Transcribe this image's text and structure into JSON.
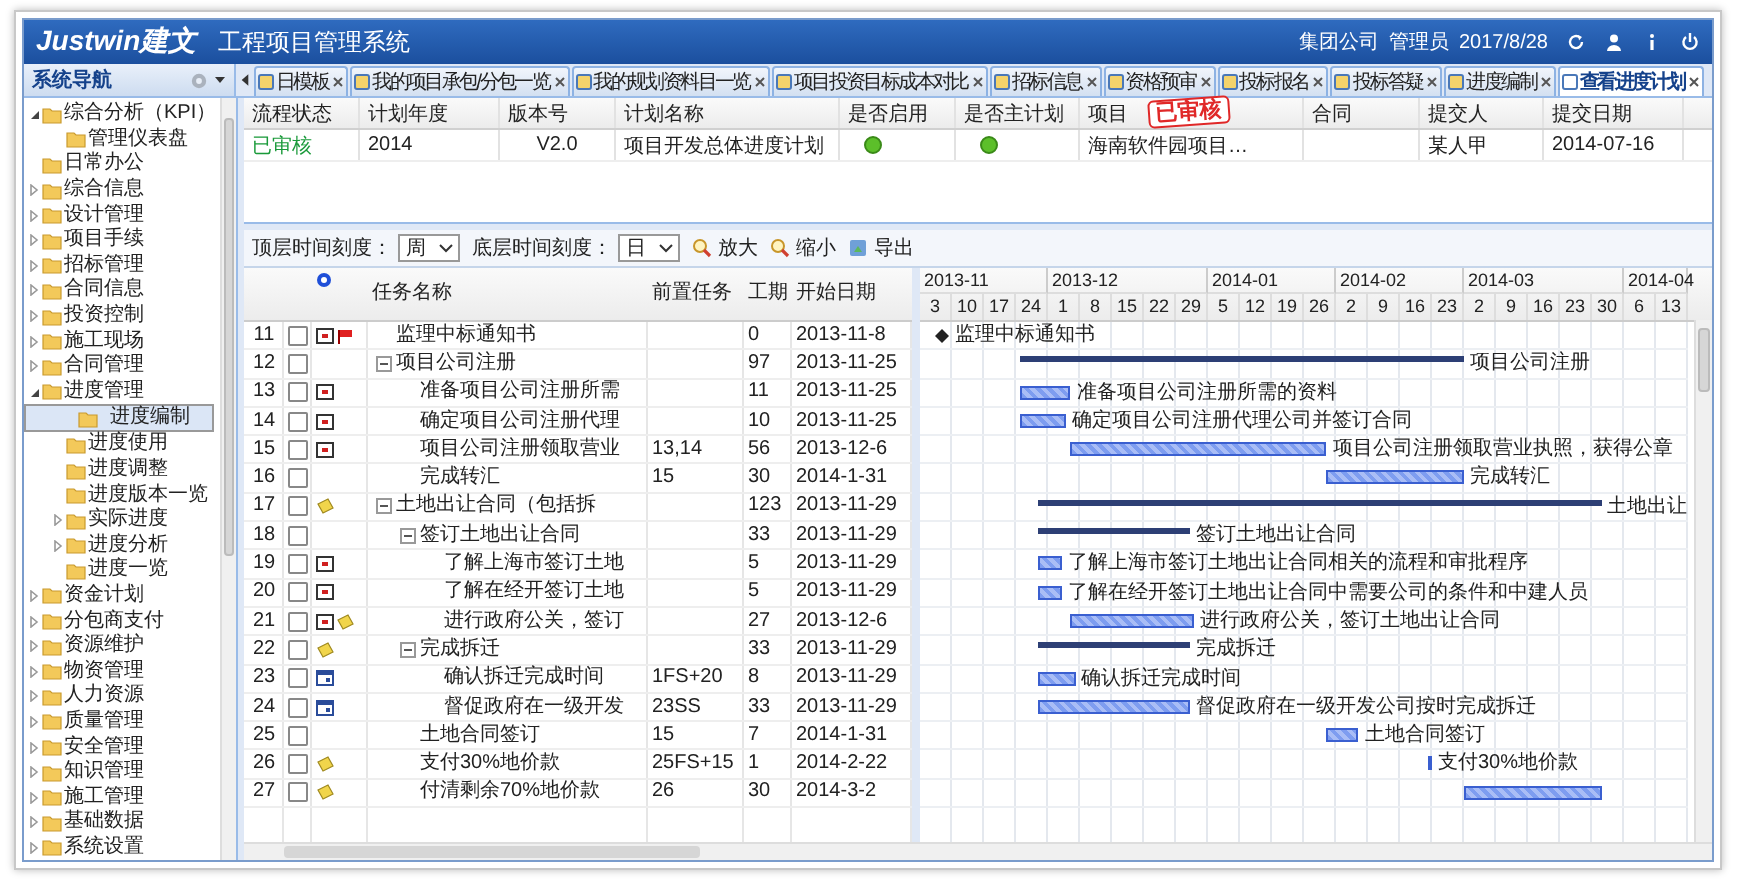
{
  "header": {
    "logo": "Justwin建文",
    "title": "工程项目管理系统",
    "company": "集团公司",
    "user": "管理员",
    "date": "2017/8/28"
  },
  "sidebar": {
    "title": "系统导航",
    "items": [
      {
        "label": "综合分析（KPI）",
        "expanded": true,
        "selected": false,
        "children": [
          {
            "label": "管理仪表盘",
            "selected": false
          }
        ]
      },
      {
        "label": "日常办公",
        "selected": false
      },
      {
        "label": "综合信息",
        "expanded": false,
        "selected": false
      },
      {
        "label": "设计管理",
        "expanded": false,
        "selected": false
      },
      {
        "label": "项目手续",
        "expanded": false,
        "selected": false
      },
      {
        "label": "招标管理",
        "expanded": false,
        "selected": false
      },
      {
        "label": "合同信息",
        "expanded": false,
        "selected": false
      },
      {
        "label": "投资控制",
        "expanded": false,
        "selected": false
      },
      {
        "label": "施工现场",
        "expanded": false,
        "selected": false
      },
      {
        "label": "合同管理",
        "expanded": false,
        "selected": false
      },
      {
        "label": "进度管理",
        "expanded": true,
        "selected": false,
        "children": [
          {
            "label": "进度编制",
            "selected": true
          },
          {
            "label": "进度使用",
            "selected": false
          },
          {
            "label": "进度调整",
            "selected": false
          },
          {
            "label": "进度版本一览",
            "selected": false
          },
          {
            "label": "实际进度",
            "expanded": false,
            "selected": false
          },
          {
            "label": "进度分析",
            "expanded": false,
            "selected": false
          },
          {
            "label": "进度一览",
            "selected": false
          }
        ]
      },
      {
        "label": "资金计划",
        "expanded": false,
        "selected": false
      },
      {
        "label": "分包商支付",
        "expanded": false,
        "selected": false
      },
      {
        "label": "资源维护",
        "expanded": false,
        "selected": false
      },
      {
        "label": "物资管理",
        "expanded": false,
        "selected": false
      },
      {
        "label": "人力资源",
        "expanded": false,
        "selected": false
      },
      {
        "label": "质量管理",
        "expanded": false,
        "selected": false
      },
      {
        "label": "安全管理",
        "expanded": false,
        "selected": false
      },
      {
        "label": "知识管理",
        "expanded": false,
        "selected": false
      },
      {
        "label": "施工管理",
        "expanded": false,
        "selected": false
      },
      {
        "label": "基础数据",
        "expanded": false,
        "selected": false
      },
      {
        "label": "系统设置",
        "expanded": false,
        "selected": false
      }
    ]
  },
  "tabs": [
    {
      "label": "日模板",
      "selected": false
    },
    {
      "label": "我的项目承包/分包一览",
      "selected": false
    },
    {
      "label": "我的规划资料目一览",
      "selected": false
    },
    {
      "label": "项目投资目标成本对比",
      "selected": false
    },
    {
      "label": "招标信息",
      "selected": false
    },
    {
      "label": "资格预审",
      "selected": false
    },
    {
      "label": "投标报名",
      "selected": false
    },
    {
      "label": "投标答疑",
      "selected": false
    },
    {
      "label": "进度编制",
      "selected": false
    },
    {
      "label": "查看进度计划",
      "selected": true
    }
  ],
  "plan_table": {
    "columns": [
      "流程状态",
      "计划年度",
      "版本号",
      "计划名称",
      "是否启用",
      "是否主计划",
      "项目",
      "合同",
      "提交人",
      "提交日期"
    ],
    "stamp": "已审核",
    "rows": [
      {
        "status": "已审核",
        "year": "2014",
        "version": "V2.0",
        "name": "项目开发总体进度计划",
        "enabled": true,
        "main_plan": true,
        "project": "海南软件园项目…",
        "submitter": "某人甲",
        "date": "2014-07-16"
      }
    ]
  },
  "toolbar": {
    "top_scale_label": "顶层时间刻度：",
    "top_scale": "周",
    "bottom_scale_label": "底层时间刻度：",
    "bottom_scale": "日",
    "zoom_in": "放大",
    "zoom_out": "缩小",
    "export": "导出"
  },
  "gantt": {
    "columns": [
      "任务名称",
      "前置任务",
      "工期",
      "开始日期"
    ],
    "timeline": [
      {
        "label": "2013-11",
        "days": [
          "3",
          "10",
          "17",
          "24"
        ]
      },
      {
        "label": "2013-12",
        "days": [
          "1",
          "8",
          "15",
          "22",
          "29"
        ]
      },
      {
        "label": "2014-01",
        "days": [
          "5",
          "12",
          "19",
          "26"
        ]
      },
      {
        "label": "2014-02",
        "days": [
          "2",
          "9",
          "16",
          "23"
        ]
      },
      {
        "label": "2014-03",
        "days": [
          "2",
          "9",
          "16",
          "23",
          "30"
        ]
      },
      {
        "label": "2014-04",
        "days": [
          "6",
          "13"
        ]
      }
    ],
    "rows": [
      {
        "no": "11",
        "checked": false,
        "markers": [
          {
            "kind": "doc"
          },
          {
            "kind": "flag"
          }
        ],
        "kind": "milestone",
        "name": "监理中标通知书",
        "duration": "0",
        "start": "2013-11-8",
        "milestone_label": "监理中标通知书"
      },
      {
        "no": "12",
        "checked": false,
        "kind": "group",
        "expanded": true,
        "name": "项目公司注册",
        "duration": "97",
        "start": "2013-11-25",
        "bar_label": "项目公司注册",
        "children": [
          {
            "no": "13",
            "checked": false,
            "markers": [
              {
                "kind": "doc"
              }
            ],
            "kind": "task",
            "name": "准备项目公司注册所需",
            "duration": "11",
            "start": "2013-11-25",
            "bar_label": "准备项目公司注册所需的资料"
          },
          {
            "no": "14",
            "checked": false,
            "markers": [
              {
                "kind": "doc"
              }
            ],
            "kind": "task",
            "name": "确定项目公司注册代理",
            "duration": "10",
            "start": "2013-11-25",
            "bar_label": "确定项目公司注册代理公司并签订合同"
          },
          {
            "no": "15",
            "checked": false,
            "markers": [
              {
                "kind": "doc"
              }
            ],
            "kind": "task",
            "name": "项目公司注册领取营业",
            "predecessor": "13,14",
            "duration": "56",
            "start": "2013-12-6",
            "bar_label": "项目公司注册领取营业执照，获得公章"
          },
          {
            "no": "16",
            "checked": false,
            "kind": "task",
            "name": "完成转汇",
            "predecessor": "15",
            "duration": "30",
            "start": "2014-1-31",
            "bar_label": "完成转汇"
          }
        ]
      },
      {
        "no": "17",
        "checked": false,
        "markers": [
          {
            "kind": "note"
          }
        ],
        "kind": "group",
        "expanded": true,
        "name": "土地出让合同（包括拆",
        "duration": "123",
        "start": "2013-11-29",
        "bar_label": "土地出让",
        "children": [
          {
            "no": "18",
            "checked": false,
            "kind": "group",
            "expanded": true,
            "name": "签订土地出让合同",
            "duration": "33",
            "start": "2013-11-29",
            "bar_label": "签订土地出让合同",
            "children": [
              {
                "no": "19",
                "checked": false,
                "markers": [
                  {
                    "kind": "doc"
                  }
                ],
                "kind": "task",
                "name": "了解上海市签订土地",
                "duration": "5",
                "start": "2013-11-29",
                "bar_label": "了解上海市签订土地出让合同相关的流程和审批程序"
              },
              {
                "no": "20",
                "checked": false,
                "markers": [
                  {
                    "kind": "doc"
                  }
                ],
                "kind": "task",
                "name": "了解在经开签订土地",
                "duration": "5",
                "start": "2013-11-29",
                "bar_label": "了解在经开签订土地出让合同中需要公司的条件和中建人员"
              },
              {
                "no": "21",
                "checked": false,
                "markers": [
                  {
                    "kind": "doc"
                  },
                  {
                    "kind": "note"
                  }
                ],
                "kind": "task",
                "name": "进行政府公关，签订",
                "duration": "27",
                "start": "2013-12-6",
                "bar_label": "进行政府公关，签订土地出让合同"
              }
            ]
          },
          {
            "no": "22",
            "checked": false,
            "markers": [
              {
                "kind": "note"
              }
            ],
            "kind": "group",
            "expanded": true,
            "name": "完成拆迁",
            "duration": "33",
            "start": "2013-11-29",
            "bar_label": "完成拆迁",
            "children": [
              {
                "no": "23",
                "checked": false,
                "markers": [
                  {
                    "kind": "calendar"
                  }
                ],
                "kind": "task",
                "name": "确认拆迁完成时间",
                "predecessor": "1FS+20",
                "duration": "8",
                "start": "2013-11-29",
                "bar_label": "确认拆迁完成时间"
              },
              {
                "no": "24",
                "checked": false,
                "markers": [
                  {
                    "kind": "calendar"
                  }
                ],
                "kind": "task",
                "name": "督促政府在一级开发",
                "predecessor": "23SS",
                "duration": "33",
                "start": "2013-11-29",
                "bar_label": "督促政府在一级开发公司按时完成拆迁"
              }
            ]
          },
          {
            "no": "25",
            "checked": false,
            "kind": "task",
            "name": "土地合同签订",
            "predecessor": "15",
            "duration": "7",
            "start": "2014-1-31",
            "bar_label": "土地合同签订"
          },
          {
            "no": "26",
            "checked": false,
            "markers": [
              {
                "kind": "note"
              }
            ],
            "kind": "task",
            "name": "支付30%地价款",
            "predecessor": "25FS+15",
            "duration": "1",
            "start": "2014-2-22",
            "bar_label": "支付30%地价款"
          },
          {
            "no": "27",
            "checked": false,
            "markers": [
              {
                "kind": "note"
              }
            ],
            "kind": "task",
            "name": "付清剩余70%地价款",
            "predecessor": "26",
            "duration": "30",
            "start": "2014-3-2"
          }
        ]
      }
    ]
  }
}
